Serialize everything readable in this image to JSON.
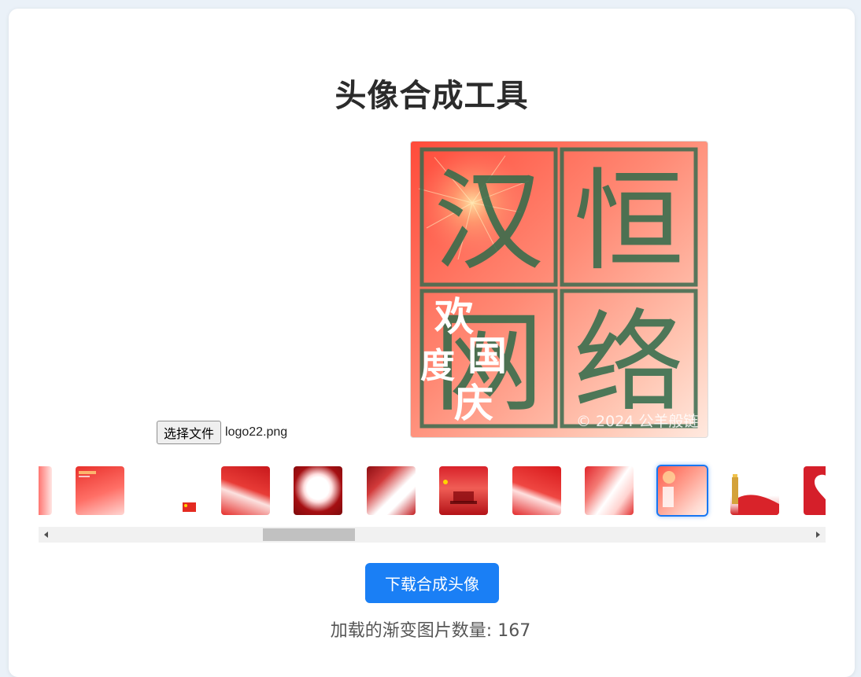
{
  "page": {
    "title": "头像合成工具"
  },
  "upload": {
    "button_label": "选择文件",
    "file_name": "logo22.png"
  },
  "preview": {
    "characters": [
      "汉",
      "恒",
      "网",
      "络"
    ],
    "overlay_text": [
      "欢",
      "度",
      "国",
      "庆"
    ],
    "watermark": "© 2024 公羊般链"
  },
  "thumbnails": [
    {
      "style": "red-soft"
    },
    {
      "style": "red-fade-text"
    },
    {
      "style": "flag-small"
    },
    {
      "style": "red-banner"
    },
    {
      "style": "dark-red-circle"
    },
    {
      "style": "diagonal-fade"
    },
    {
      "style": "gate"
    },
    {
      "style": "red-banner-2"
    },
    {
      "style": "calligraphy"
    },
    {
      "style": "selected-soft",
      "selected": true
    },
    {
      "style": "tower"
    },
    {
      "style": "heart"
    }
  ],
  "actions": {
    "download_label": "下载合成头像"
  },
  "status": {
    "count_text": "加载的渐变图片数量: 167"
  },
  "colors": {
    "accent": "#1a7ff5",
    "selected_border": "#1877f2"
  }
}
